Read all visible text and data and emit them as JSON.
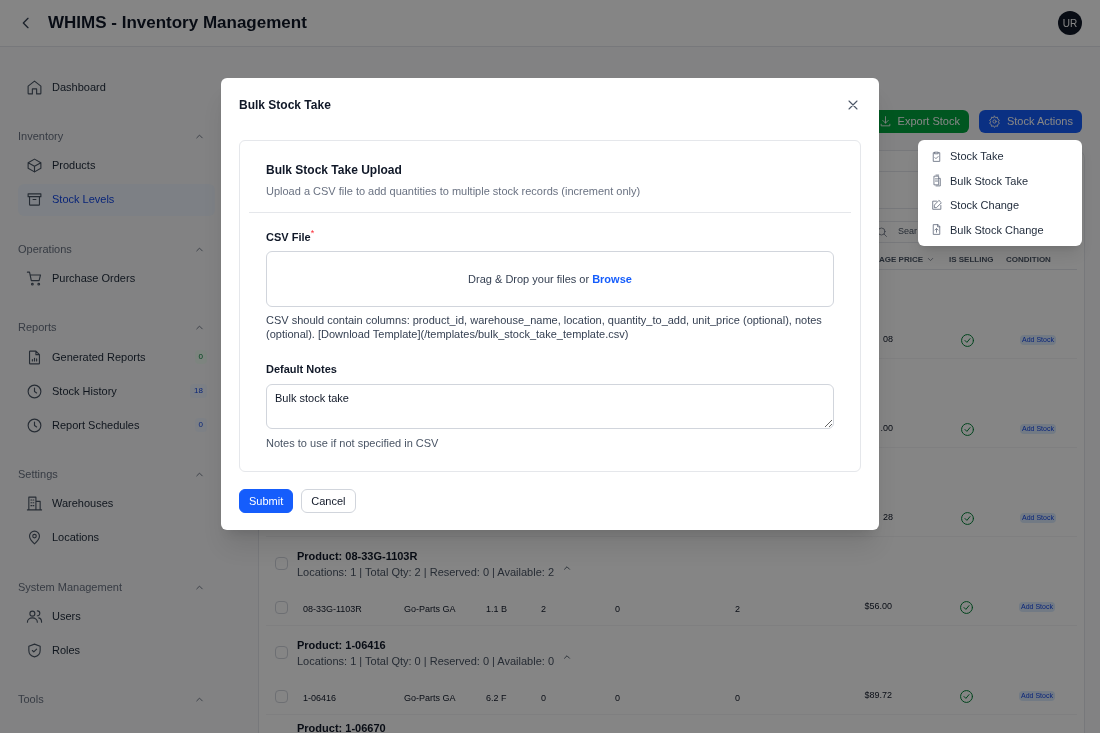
{
  "header": {
    "title": "WHIMS - Inventory Management",
    "avatar": "UR"
  },
  "sidebar": {
    "top_items": [
      {
        "label": "Dashboard",
        "selected": false
      }
    ],
    "sections": [
      {
        "title": "Inventory",
        "expanded": true,
        "items": [
          {
            "label": "Products",
            "selected": false
          },
          {
            "label": "Stock Levels",
            "selected": true
          }
        ]
      },
      {
        "title": "Operations",
        "expanded": true,
        "items": [
          {
            "label": "Purchase Orders",
            "selected": false
          }
        ]
      },
      {
        "title": "Reports",
        "expanded": true,
        "items": [
          {
            "label": "Generated Reports",
            "selected": false,
            "badge": "0",
            "kind": "success"
          },
          {
            "label": "Stock History",
            "selected": false,
            "badge": "18",
            "kind": "info"
          },
          {
            "label": "Report Schedules",
            "selected": false,
            "badge": "0",
            "kind": "info"
          }
        ]
      },
      {
        "title": "Settings",
        "expanded": true,
        "items": [
          {
            "label": "Warehouses",
            "selected": false
          },
          {
            "label": "Locations",
            "selected": false
          }
        ]
      },
      {
        "title": "System Management",
        "expanded": true,
        "items": [
          {
            "label": "Users",
            "selected": false
          },
          {
            "label": "Roles",
            "selected": false
          }
        ]
      },
      {
        "title": "Tools",
        "expanded": true
      }
    ]
  },
  "toolbar": {
    "buttons": [
      {
        "label": "Export Stock",
        "kind": "export"
      },
      {
        "label": "Stock Actions",
        "kind": "actions"
      }
    ]
  },
  "search": {
    "placeholder": "Sear"
  },
  "table": {
    "columns": [
      "AGE PRICE",
      "IS SELLING",
      "CONDITION"
    ],
    "partial_rows": [
      {
        "price": "08",
        "selling": true,
        "condition": "Add Stock"
      },
      {
        "price": ".00",
        "selling": true,
        "condition": "Add Stock"
      },
      {
        "price": "28",
        "selling": true,
        "condition": "Add Stock"
      }
    ],
    "groups": [
      {
        "title": "Product: 08-33G-1103R",
        "checked": false,
        "summary": "Locations: 1 | Total Qty: 2 | Reserved: 0 | Available: 2",
        "expanded": true,
        "rows": [
          {
            "checked": false,
            "cells": [
              "08-33G-1103R",
              "Go-Parts GA",
              "1.1 B",
              "2",
              "0",
              "2"
            ],
            "price": "$56.00",
            "selling": true,
            "condition": "Add Stock"
          }
        ]
      },
      {
        "title": "Product: 1-06416",
        "checked": false,
        "summary": "Locations: 1 | Total Qty: 0 | Reserved: 0 | Available: 0",
        "expanded": true,
        "rows": [
          {
            "checked": false,
            "cells": [
              "1-06416",
              "Go-Parts GA",
              "6.2 F",
              "0",
              "0",
              "0"
            ],
            "price": "$89.72",
            "selling": true,
            "condition": "Add Stock"
          }
        ]
      },
      {
        "title": "Product: 1-06670"
      }
    ]
  },
  "menu": {
    "items": [
      "Stock Take",
      "Bulk Stock Take",
      "Stock Change",
      "Bulk Stock Change"
    ]
  },
  "modal": {
    "title": "Bulk Stock Take",
    "heading": "Bulk Stock Take Upload",
    "subtitle": "Upload a CSV file to add quantities to multiple stock records (increment only)",
    "file_field": {
      "label": "CSV File",
      "required": true,
      "required_mark": "*",
      "drop_text": "Drag & Drop your files or",
      "browse": "Browse",
      "help": "CSV should contain columns: product_id, warehouse_name, location, quantity_to_add, unit_price (optional), notes (optional). [Download Template](/templates/bulk_stock_take_template.csv)"
    },
    "notes_field": {
      "label": "Default Notes",
      "value": "Bulk stock take",
      "hint": "Notes to use if not specified in CSV"
    },
    "buttons": [
      {
        "label": "Submit",
        "kind": "primary"
      },
      {
        "label": "Cancel",
        "kind": "secondary"
      }
    ]
  }
}
